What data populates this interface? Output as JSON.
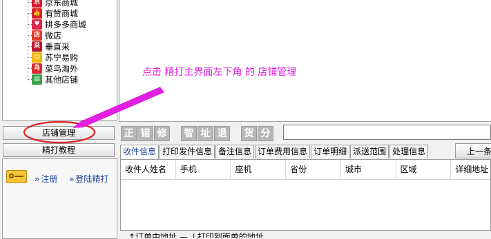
{
  "tree": {
    "items": [
      {
        "label": "京东商城",
        "icon": "jd-icon",
        "color": "#d8202b",
        "glyph": "京"
      },
      {
        "label": "有赞商城",
        "icon": "youzan-thumb-icon",
        "color": "#d8202b",
        "glyph": "👍"
      },
      {
        "label": "拼多多商城",
        "icon": "pinduoduo-icon",
        "color": "#e0264a",
        "glyph": "♥"
      },
      {
        "label": "微店",
        "icon": "weidian-icon",
        "color": "#e23a2a",
        "glyph": "店"
      },
      {
        "label": "垂直采",
        "icon": "chuizhicai-icon",
        "color": "#c0152e",
        "glyph": "采"
      },
      {
        "label": "苏宁易购",
        "icon": "suning-icon",
        "color": "#f2b705",
        "glyph": "☺"
      },
      {
        "label": "菜鸟淘外",
        "icon": "cainiao-icon",
        "color": "#d82a2a",
        "glyph": "鸟"
      },
      {
        "label": "其他店铺",
        "icon": "other-store-icon",
        "color": "#39a24a",
        "glyph": "▤"
      }
    ]
  },
  "left_buttons": {
    "store_manage": "店铺管理",
    "tutorial": "精打教程"
  },
  "left_links": {
    "register": "注册",
    "login": "登陆精打"
  },
  "annotation": {
    "text": "点击  精打主界面左下角  的  店铺管理",
    "color": "#e01fe0"
  },
  "toolbar": {
    "group1": [
      "正",
      "错",
      "修"
    ],
    "group2": [
      "智",
      "址",
      "退"
    ],
    "group3": [
      "货",
      "分"
    ]
  },
  "tabs": [
    "收件信息",
    "打印发件信息",
    "备注信息",
    "订单费用信息",
    "订单明细",
    "派送范围",
    "处理信息"
  ],
  "prev_button": "上一条",
  "grid": {
    "columns": [
      "收件人姓名",
      "手机",
      "座机",
      "省份",
      "城市",
      "区域",
      "详细地址"
    ]
  },
  "footer_hint": "↑订单中地址  —  ↓打印到面单的地址",
  "colors": {
    "accent": "#1b3f9b",
    "annotation": "#e01fe0",
    "circle": "#e02020"
  }
}
